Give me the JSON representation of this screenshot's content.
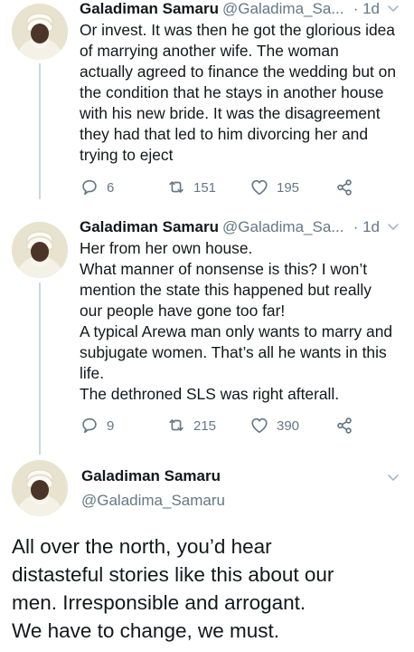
{
  "tweets": [
    {
      "name": "Galadiman Samaru",
      "handle": "@Galadima_Sa...",
      "time": "· 1d",
      "text": "Or invest. It was then he got the glorious idea\nof marrying another wife. The woman\nactually agreed to finance the wedding but on\nthe condition that he stays in another house\nwith his new bride. It was the disagreement\nthey had that led to him divorcing her and\ntrying to eject",
      "replies": "6",
      "retweets": "151",
      "likes": "195"
    },
    {
      "name": "Galadiman Samaru",
      "handle": "@Galadima_Sa...",
      "time": "· 1d",
      "text": "Her from her own house.\nWhat manner of nonsense is this? I won’t\nmention the state this happened but really\nour people have gone too far!\nA typical Arewa man only wants to marry and\nsubjugate women. That’s all he wants in this\nlife.\nThe dethroned SLS was right afterall.",
      "replies": "9",
      "retweets": "215",
      "likes": "390"
    }
  ],
  "main_tweet": {
    "name": "Galadiman Samaru",
    "handle": "@Galadima_Samaru",
    "text": "All over the north, you’d hear\ndistasteful stories like this about our\nmen. Irresponsible and arrogant.\nWe have to change, we must."
  },
  "colors": {
    "text": "#14171a",
    "muted": "#657786",
    "line": "#ccd6dd"
  },
  "icons": [
    "avatar",
    "chevron-down-icon",
    "reply-icon",
    "retweet-icon",
    "like-icon",
    "share-icon"
  ]
}
